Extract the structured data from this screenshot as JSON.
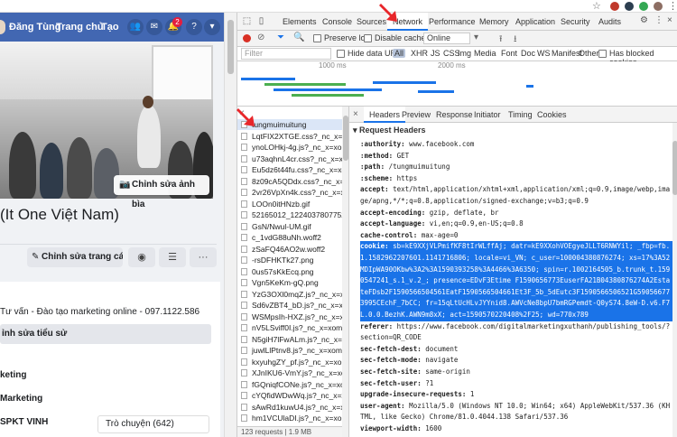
{
  "facebook": {
    "topbar": {
      "user_name": "Đăng Tùng",
      "home": "Trang chủ",
      "create": "Tạo",
      "notification_count": "2"
    },
    "cover_button": "Chỉnh sửa ảnh bìa",
    "page_name": "(It One Việt Nam)",
    "edit_page_button": "Chỉnh sửa trang cá ...",
    "intro": {
      "description": "Tư vấn - Đào tạo marketing online - 097.1122.586",
      "edit_bio": "ỉnh sửa tiểu sử",
      "line1": "keting",
      "line2": "Marketing",
      "line3": "SPKT VINH"
    },
    "followers_button": "Trò chuyện (642)"
  },
  "devtools": {
    "tabs": [
      "Elements",
      "Console",
      "Sources",
      "Network",
      "Performance",
      "Memory",
      "Application",
      "Security",
      "Audits"
    ],
    "active_tab": "Network",
    "toolbar": {
      "preserve_log": "Preserve log",
      "disable_cache": "Disable cache",
      "throttle": "Online"
    },
    "filter": {
      "placeholder": "Filter",
      "hide_data_urls": "Hide data URLs",
      "types": [
        "All",
        "XHR",
        "JS",
        "CSS",
        "Img",
        "Media",
        "Font",
        "Doc",
        "WS",
        "Manifest",
        "Other"
      ],
      "has_blocked": "Has blocked cookies"
    },
    "overview_ticks": [
      "1000 ms",
      "2000 ms"
    ],
    "requests": [
      "tungmuimuitung",
      "LqtFIX2XTGE.css?_nc_x=xomAl",
      "ynoLOHkj-4g.js?_nc_x=xomAl",
      "u73aqhnL4cr.css?_nc_x=xomAl",
      "Eu5dz6t44fu.css?_nc_x=xomAl",
      "8z09cA5QDdx.css?_nc_x=xomAl",
      "2vr26VpXn4k.css?_nc_x=xomAl",
      "LOOn0itHNzb.gif",
      "52165012_122403780775223",
      "GsN/Nwul-UM.gif",
      "c_1vdG88uNh.woff2",
      "zSaFQ46AO2w.woff2",
      "-rsDFHKTk27.png",
      "0us57sKkEcq.png",
      "Vgn5KeKm-gQ.png",
      "YzG3OXl0mqZ.js?_nc_x=xomAl",
      "Sd6vZBT4_bD.js?_nc_x=xomAl",
      "WSMpsIh-HXZ.js?_nc_x=xomAl",
      "nV5LSviff0I.js?_nc_x=xomAl",
      "N5giH7lFwALm.js?_nc_x=xomAl",
      "juwlLlPtnv8.js?_nc_x=xomAl",
      "kxyuhgZY_pf.js?_nc_x=xomAl",
      "XJnIKU6-VmY.js?_nc_x=xomAl",
      "fGQniqfCONe.js?_nc_x=xomAl",
      "cYQfidWDwWq.js?_nc_x=xomAl",
      "sAwRd1kuwU4.js?_nc_x=xomAl",
      "hm1VCUlaDI.js?_nc_x=xomAl"
    ],
    "list_status": "123 requests | 1.9 MB transferred",
    "detail_tabs": [
      "Headers",
      "Preview",
      "Response",
      "Initiator",
      "Timing",
      "Cookies"
    ],
    "active_detail_tab": "Headers",
    "section_title": "Request Headers",
    "headers": [
      {
        "k": ":authority:",
        "v": " www.facebook.com"
      },
      {
        "k": ":method:",
        "v": " GET"
      },
      {
        "k": ":path:",
        "v": " /tungmuimuitung"
      },
      {
        "k": ":scheme:",
        "v": " https"
      },
      {
        "k": "accept:",
        "v": " text/html,application/xhtml+xml,application/xml;q=0.9,image/webp,image/apng,*/*;q=0.8,application/signed-exchange;v=b3;q=0.9"
      },
      {
        "k": "accept-encoding:",
        "v": " gzip, deflate, br"
      },
      {
        "k": "accept-language:",
        "v": " vi,en;q=0.9,en-US;q=0.8"
      },
      {
        "k": "cache-control:",
        "v": " max-age=0"
      },
      {
        "k": "cookie:",
        "v": " sb=kE9XXjVLPmifKF8tIrWLffAj; datr=kE9XXohVOEgyeJLLT6RNWYil; _fbp=fb.1.1582962207601.1141716806; locale=vi_VN; c_user=100004380876274; xs=17%3A52MDIpWA90OKbw%3A2%3A1590393258%3A4466%3A6350; spin=r.1002164505_b.trunk_t.1590547241_s.1_v.2_; presence=EDvF3Etime F1590656773EuserFA21B04380876274A2EstateFDsb2F1590566504561EatF1590566504661Et3F_5b_5dEutc3F1590566506521G590566773995CEchF_7bCC; fr=15qLtUcHLvJYYnid8.AWVcNe8bpU7bmRGPemdt-Q0yS74.8eW-D.v6.F7L.0.0.BezhK.AWN9m8xX; act=1590570220408%2F25; wd=770x789",
        "selected": true
      },
      {
        "k": "referer:",
        "v": " https://www.facebook.com/digitalmarketingxuthanh/publishing_tools/?section=QR_CODE"
      },
      {
        "k": "sec-fetch-dest:",
        "v": " document"
      },
      {
        "k": "sec-fetch-mode:",
        "v": " navigate"
      },
      {
        "k": "sec-fetch-site:",
        "v": " same-origin"
      },
      {
        "k": "sec-fetch-user:",
        "v": " ?1"
      },
      {
        "k": "upgrade-insecure-requests:",
        "v": " 1"
      },
      {
        "k": "user-agent:",
        "v": " Mozilla/5.0 (Windows NT 10.0; Win64; x64) AppleWebKit/537.36 (KHTML, like Gecko) Chrome/81.0.4044.138 Safari/537.36"
      },
      {
        "k": "viewport-width:",
        "v": " 1600"
      }
    ]
  },
  "colors": {
    "fb_blue": "#4267b2",
    "selection": "#1a73e8",
    "record": "#d93025",
    "arrow": "#e8262a"
  }
}
